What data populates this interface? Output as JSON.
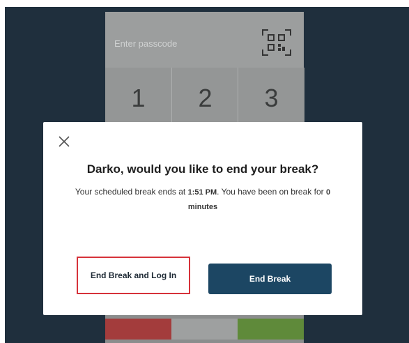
{
  "keypad": {
    "passcode_placeholder": "Enter passcode",
    "digits": [
      "1",
      "2",
      "3"
    ]
  },
  "dialog": {
    "title": "Darko, would you like to end your break?",
    "body_prefix": "Your scheduled break ends at ",
    "break_end_time": "1:51 PM",
    "body_middle": ". You have been on break for ",
    "break_duration": "0 minutes",
    "end_break_login_label": "End Break and Log In",
    "end_break_label": "End Break"
  },
  "colors": {
    "primary_button": "#1c4663",
    "highlight_outline": "#d6323a",
    "background_dark": "#1f2f3d"
  }
}
